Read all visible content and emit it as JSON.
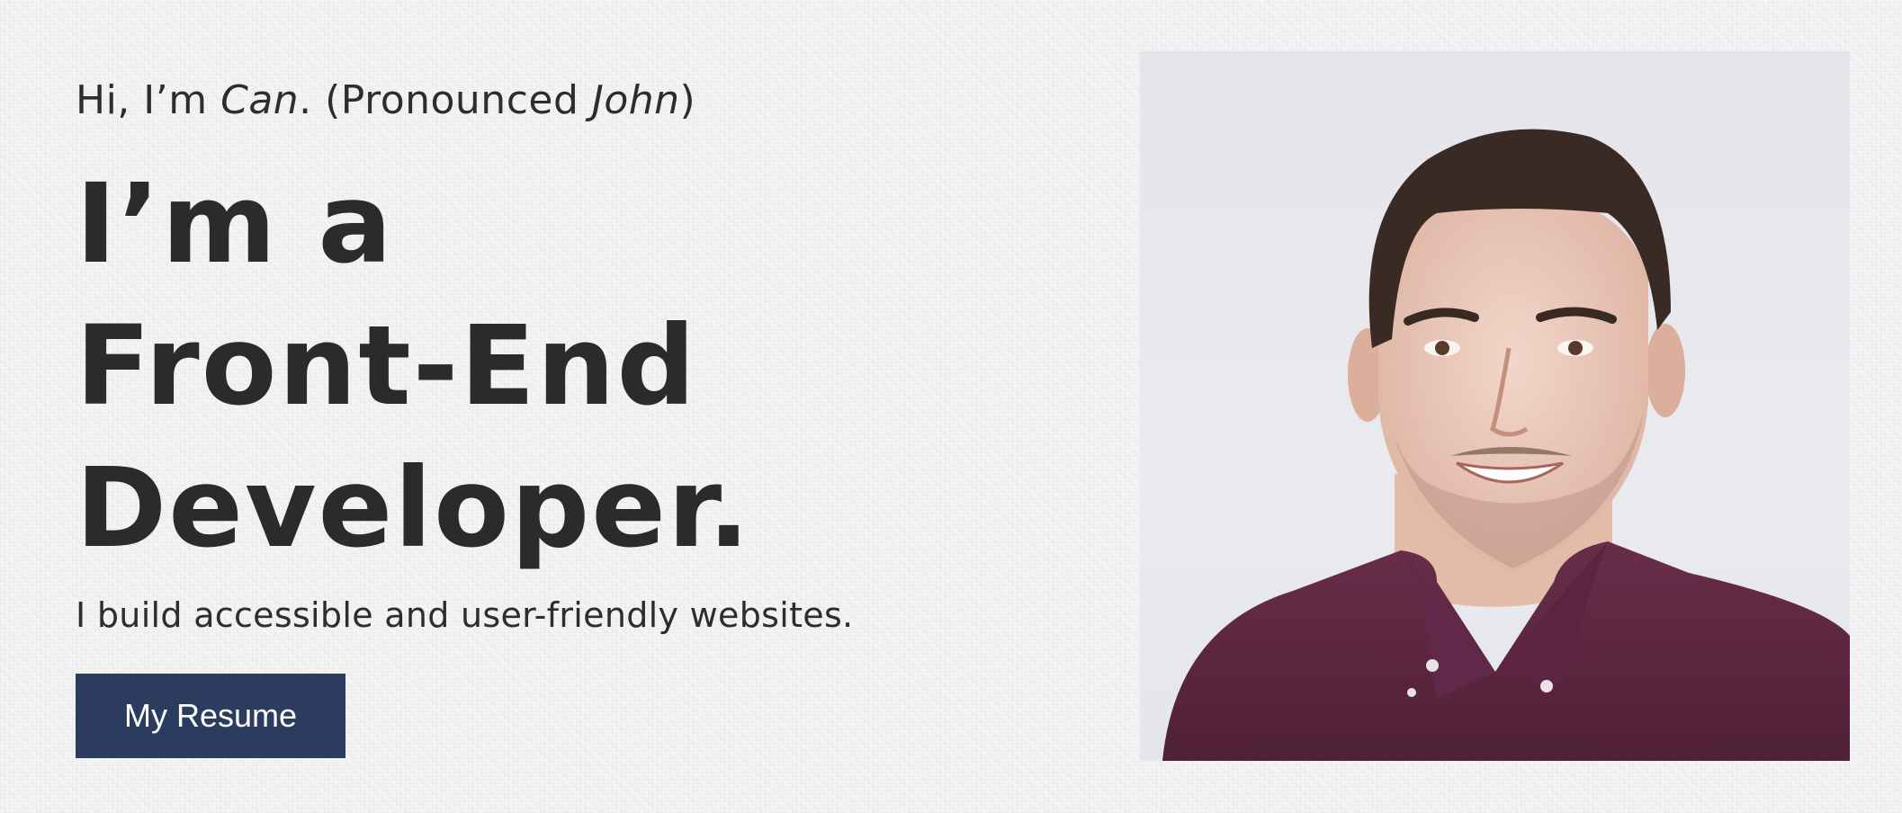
{
  "hero": {
    "greeting_prefix": "Hi, I’m ",
    "greeting_name": "Can",
    "greeting_middle": ". (Pronounced ",
    "greeting_pronounced": "John",
    "greeting_suffix": ")",
    "headline_line1": "I’m a",
    "headline_line2": "Front-End",
    "headline_line3": "Developer.",
    "tagline": "I build accessible and user-friendly websites.",
    "resume_button_label": "My Resume"
  },
  "colors": {
    "background": "#f2f2f2",
    "text": "#2d2d2d",
    "button": "#2c3c5e",
    "button_text": "#ffffff",
    "shirt": "#5c2741"
  }
}
